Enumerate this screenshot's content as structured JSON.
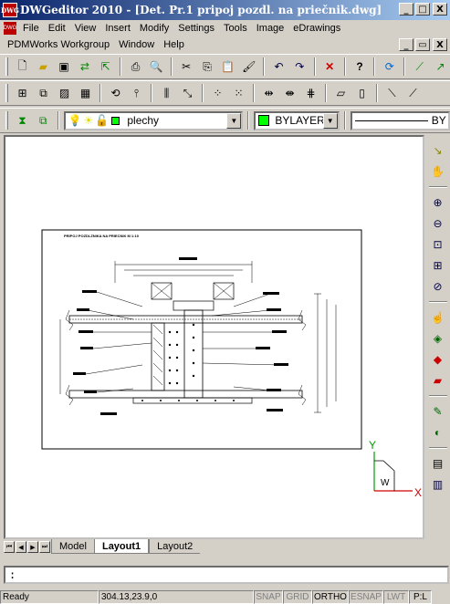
{
  "window": {
    "app_name": "DWGeditor 2010",
    "title": "DWGeditor 2010 - [Det. Pr.1 pripoj pozdl. na priečnik.dwg]",
    "app_icon_text": "DWG"
  },
  "caption_buttons": {
    "minimize": "_",
    "maximize": "□",
    "close": "X",
    "restore": "▭"
  },
  "menu": {
    "row1": [
      "File",
      "Edit",
      "View",
      "Insert",
      "Modify",
      "Settings",
      "Tools",
      "Image",
      "eDrawings"
    ],
    "row2": [
      "PDMWorks Workgroup",
      "Window",
      "Help"
    ]
  },
  "layer_toolbar": {
    "layer_name": "plechy",
    "color_label": "BYLAYER",
    "linetype_label": "BY",
    "layer_color": "#00ff00"
  },
  "drawing": {
    "heading": "PRIPOJ POZDLZNIKA NA PRIECNIK  M 1:10",
    "ucs_y": "Y",
    "ucs_x": "X",
    "ucs_w": "W"
  },
  "tabs": {
    "items": [
      "Model",
      "Layout1",
      "Layout2"
    ],
    "active": "Layout1"
  },
  "command_line": {
    "value": ":"
  },
  "status": {
    "text": "Ready",
    "coords": "304.13,23.9,0",
    "toggles": [
      {
        "label": "SNAP",
        "on": false
      },
      {
        "label": "GRID",
        "on": false
      },
      {
        "label": "ORTHO",
        "on": true
      },
      {
        "label": "ESNAP",
        "on": false
      },
      {
        "label": "LWT",
        "on": false
      },
      {
        "label": "P:L",
        "on": true
      }
    ]
  },
  "colors": {
    "title_start": "#0a246a",
    "title_end": "#a6caf0",
    "ucs_green": "#00a000",
    "ucs_red": "#d00000"
  }
}
